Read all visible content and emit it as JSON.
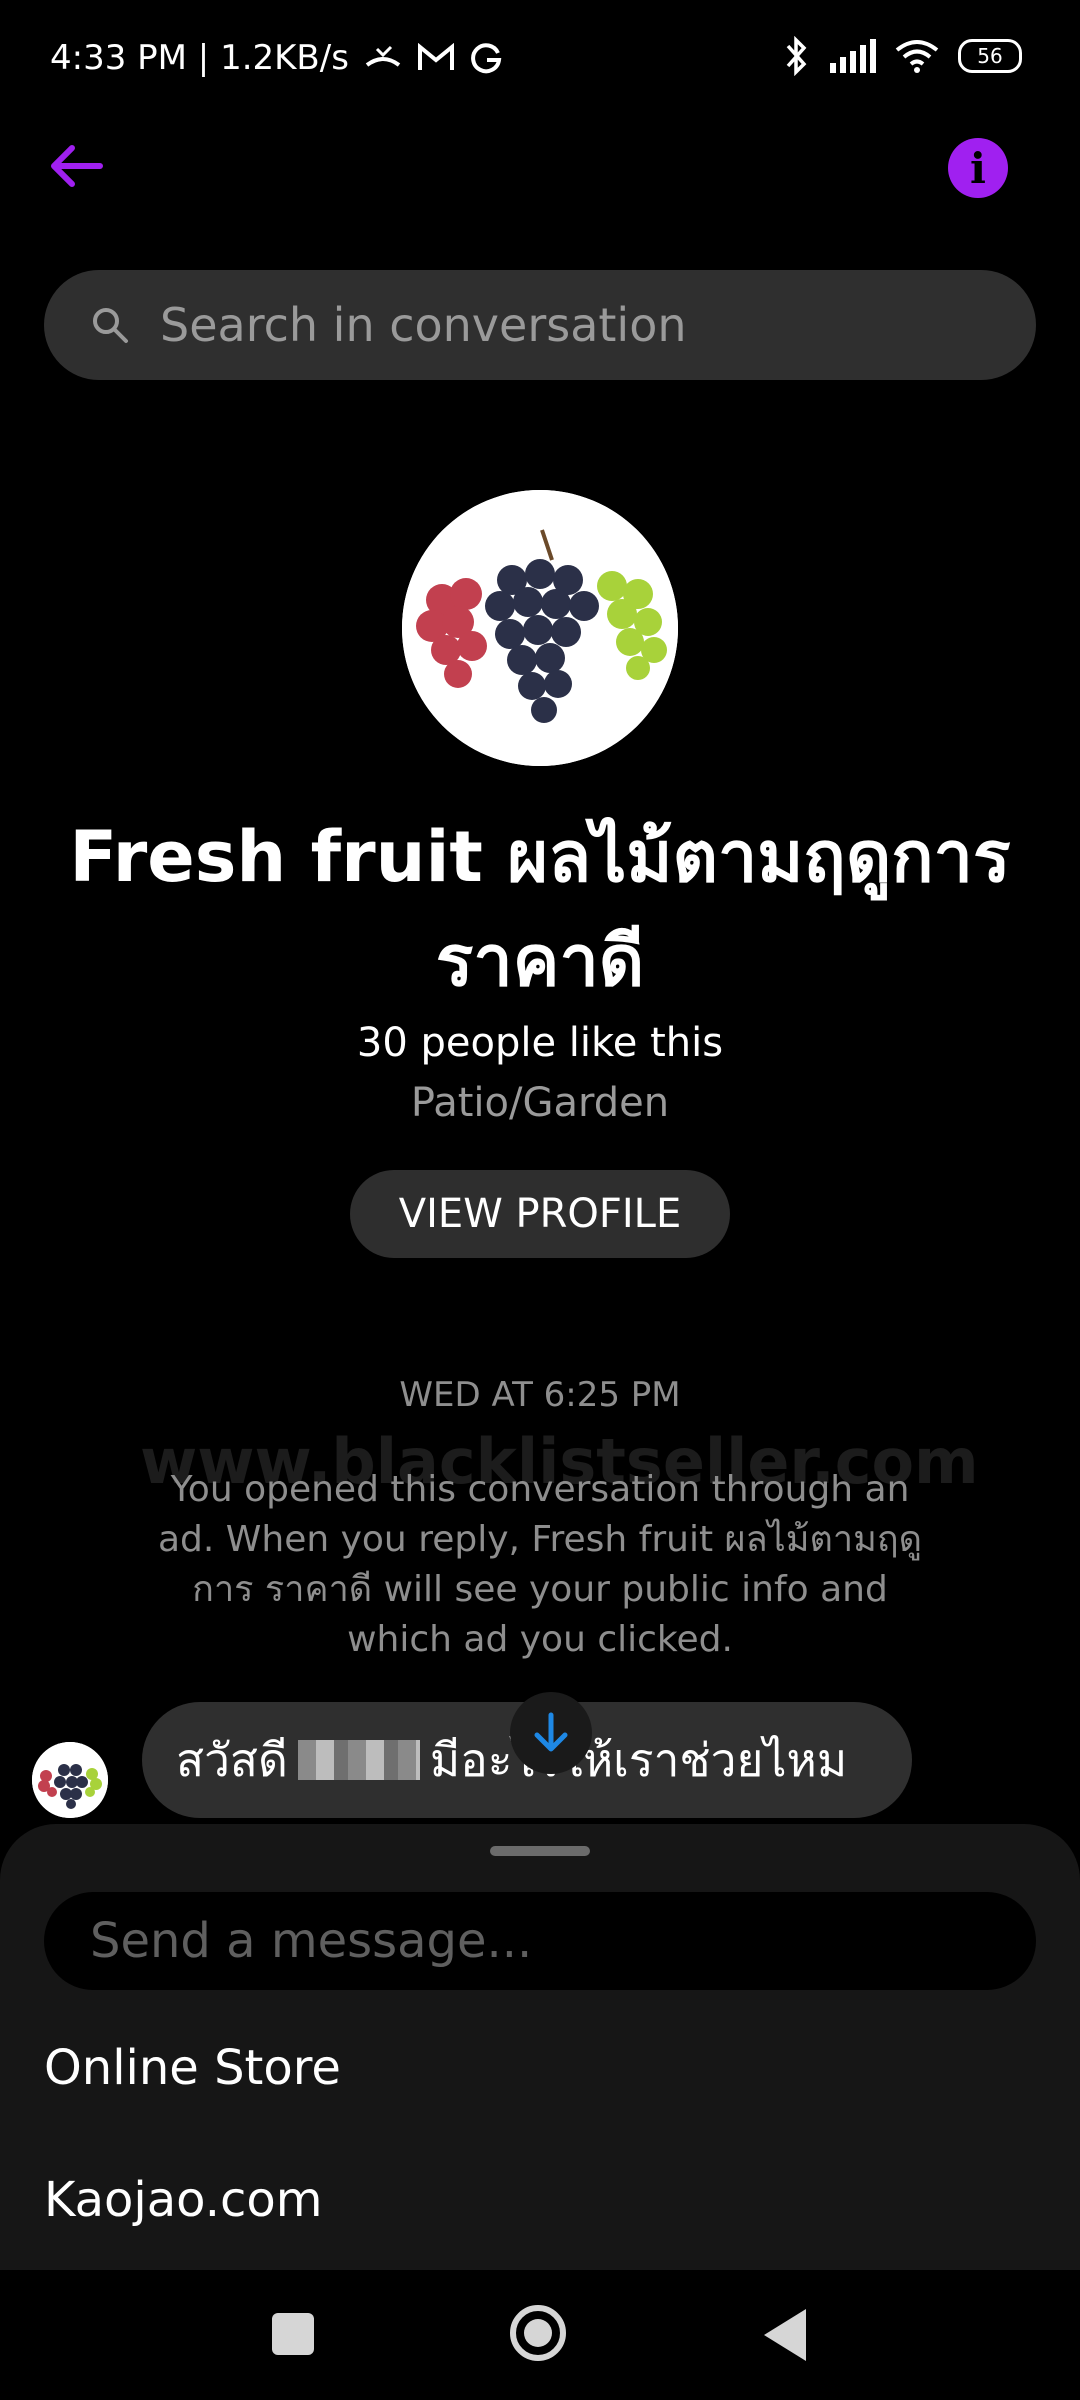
{
  "status_bar": {
    "time_speed": "4:33 PM | 1.2KB/s",
    "battery": "56"
  },
  "header": {
    "back_icon": "arrow-left-icon",
    "info_icon": "info-icon",
    "accent_color": "#a020f0"
  },
  "search": {
    "placeholder": "Search in conversation"
  },
  "profile": {
    "title": "Fresh fruit ผลไม้ตามฤดูการ ราคาดี",
    "likes": "30 people like this",
    "category": "Patio/Garden",
    "view_profile_label": "VIEW PROFILE"
  },
  "conversation": {
    "timestamp": "WED AT 6:25 PM",
    "watermark": "www.blacklistseller.com",
    "ad_note": "You opened this conversation through an ad. When you reply, Fresh fruit ผลไม้ตามฤดูการ ราคาดี will see your public info and which ad you clicked.",
    "message_start": "สวัสดี",
    "message_end": "มีอะไรให้เราช่วยไหม"
  },
  "composer": {
    "placeholder": "Send a message..."
  },
  "quick_replies": [
    "Online Store",
    "Kaojao.com"
  ]
}
